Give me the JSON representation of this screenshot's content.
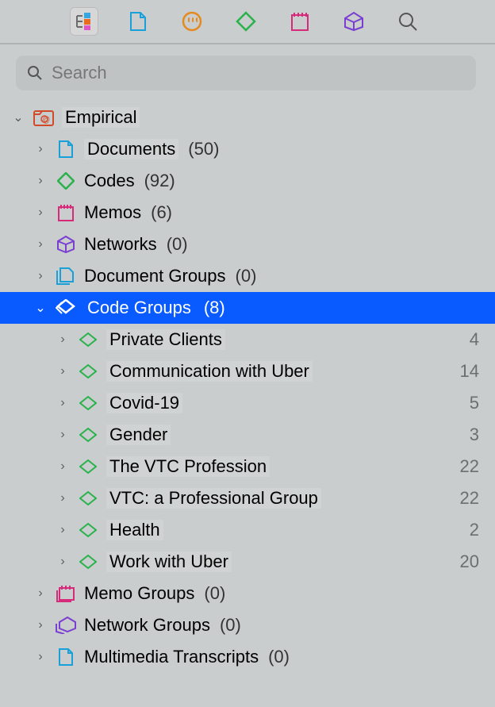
{
  "search": {
    "placeholder": "Search"
  },
  "project": {
    "name": "Empirical"
  },
  "nodes": {
    "documents": {
      "label": "Documents",
      "count": "(50)"
    },
    "codes": {
      "label": "Codes",
      "count": "(92)"
    },
    "memos": {
      "label": "Memos",
      "count": "(6)"
    },
    "networks": {
      "label": "Networks",
      "count": "(0)"
    },
    "docgroups": {
      "label": "Document Groups",
      "count": "(0)"
    },
    "codegroups": {
      "label": "Code Groups",
      "count": "(8)"
    },
    "memogroups": {
      "label": "Memo Groups",
      "count": "(0)"
    },
    "netgroups": {
      "label": "Network Groups",
      "count": "(0)"
    },
    "multimedia": {
      "label": "Multimedia Transcripts",
      "count": "(0)"
    }
  },
  "codeGroups": [
    {
      "label": "Private Clients",
      "n": "4"
    },
    {
      "label": "Communication with Uber",
      "n": "14"
    },
    {
      "label": "Covid-19",
      "n": "5"
    },
    {
      "label": "Gender",
      "n": "3"
    },
    {
      "label": "The VTC Profession",
      "n": "22"
    },
    {
      "label": "VTC: a Professional Group",
      "n": "22"
    },
    {
      "label": "Health",
      "n": "2"
    },
    {
      "label": "Work with Uber",
      "n": "20"
    }
  ]
}
